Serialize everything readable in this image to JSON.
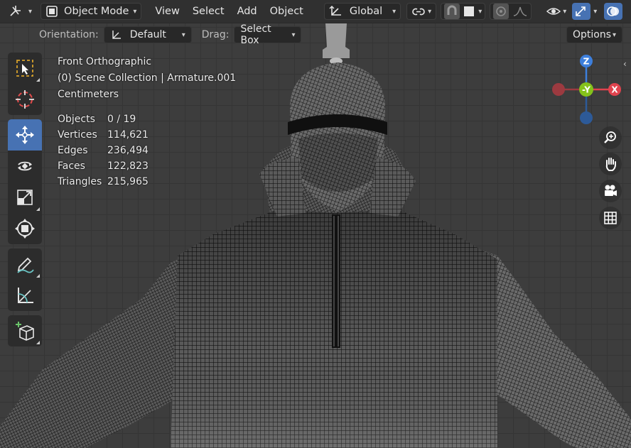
{
  "header": {
    "mode_label": "Object Mode",
    "menus": [
      "View",
      "Select",
      "Add",
      "Object"
    ],
    "transform_orientation": "Global"
  },
  "toolsettings": {
    "orientation_label": "Orientation:",
    "orientation_value": "Default",
    "drag_label": "Drag:",
    "drag_value": "Select Box",
    "options_label": "Options"
  },
  "overlay": {
    "view_name": "Front Orthographic",
    "collection_info": "(0) Scene Collection | Armature.001",
    "units": "Centimeters"
  },
  "stats": [
    {
      "key": "Objects",
      "value": "0 / 19"
    },
    {
      "key": "Vertices",
      "value": "114,621"
    },
    {
      "key": "Edges",
      "value": "236,494"
    },
    {
      "key": "Faces",
      "value": "122,823"
    },
    {
      "key": "Triangles",
      "value": "215,965"
    }
  ],
  "gizmo": {
    "z_label": "Z",
    "x_label": "X",
    "y_label": "-Y",
    "colors": {
      "x": "#e0434e",
      "y": "#84c21b",
      "z": "#3d7fdc"
    }
  },
  "toolbar_tools": [
    "select-box",
    "cursor",
    "move",
    "rotate",
    "scale",
    "transform",
    "annotate",
    "measure",
    "add-cube"
  ],
  "colors": {
    "accent": "#4772b3",
    "header_bg": "#303030",
    "viewport_bg": "#3d3d3d"
  }
}
